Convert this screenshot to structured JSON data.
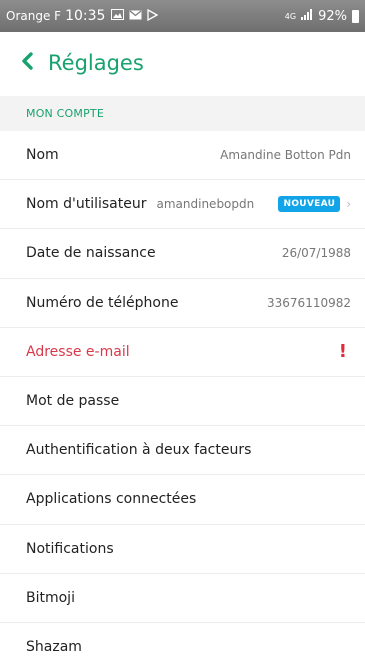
{
  "status_bar": {
    "carrier": "Orange F",
    "time": "10:35",
    "network": "4G",
    "battery": "92%"
  },
  "header": {
    "back_icon": "chevron-left-icon",
    "title": "Réglages"
  },
  "section": {
    "title": "MON COMPTE"
  },
  "rows": [
    {
      "label": "Nom",
      "value": "Amandine Botton Pdn"
    },
    {
      "label": "Nom d'utilisateur",
      "value": "amandinebopdn",
      "badge": "NOUVEAU"
    },
    {
      "label": "Date de naissance",
      "value": "26/07/1988"
    },
    {
      "label": "Numéro de téléphone",
      "value": "33676110982"
    },
    {
      "label": "Adresse e-mail",
      "alert": "!"
    },
    {
      "label": "Mot de passe"
    },
    {
      "label": "Authentification à deux facteurs"
    },
    {
      "label": "Applications connectées"
    },
    {
      "label": "Notifications"
    },
    {
      "label": "Bitmoji"
    },
    {
      "label": "Shazam"
    }
  ],
  "colors": {
    "accent": "#18a26e",
    "alert_text": "#d9394a",
    "alert_icon": "#e02b3a",
    "badge": "#12a4e8"
  }
}
